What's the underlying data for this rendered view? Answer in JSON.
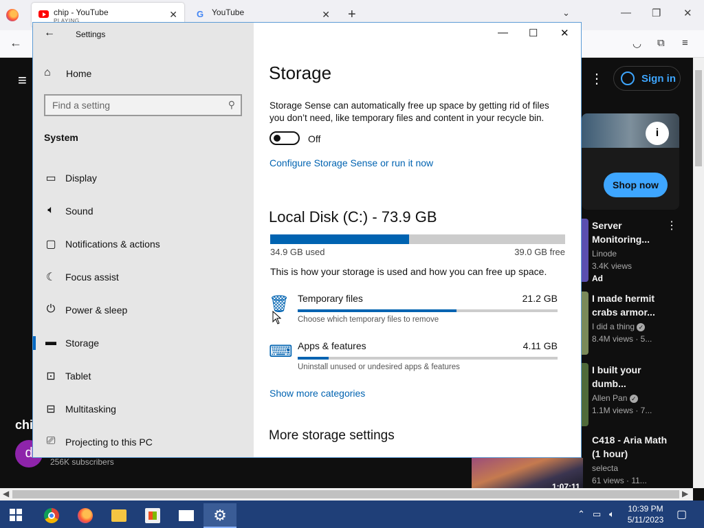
{
  "browser": {
    "tabs": [
      {
        "title": "chip - YouTube",
        "subtitle": "PLAYING",
        "active": true
      },
      {
        "title": "YouTube",
        "active": false
      }
    ]
  },
  "youtube": {
    "sign_in": "Sign in",
    "shop_now": "Shop now",
    "channel_name": "chi",
    "channel_avatar": "d",
    "subscribers": "256K subscribers",
    "bottom_duration": "1:07:11",
    "videos": [
      {
        "title": "Server Monitoring...",
        "channel": "Linode",
        "views": "3.4K views",
        "extra": "Ad"
      },
      {
        "title": "I made hermit crabs armor...",
        "channel": "I did a thing",
        "views": "8.4M views · 5..."
      },
      {
        "title": "I built your dumb...",
        "channel": "Allen Pan",
        "views": "1.1M views · 7..."
      },
      {
        "title": "C418 - Aria Math (1 hour)",
        "channel": "selecta",
        "views": "61 views · 11..."
      }
    ]
  },
  "settings": {
    "window_title": "Settings",
    "home": "Home",
    "search_placeholder": "Find a setting",
    "section": "System",
    "nav": [
      {
        "label": "Display",
        "icon": "display-icon"
      },
      {
        "label": "Sound",
        "icon": "sound-icon"
      },
      {
        "label": "Notifications & actions",
        "icon": "notifications-icon"
      },
      {
        "label": "Focus assist",
        "icon": "moon-icon"
      },
      {
        "label": "Power & sleep",
        "icon": "power-icon"
      },
      {
        "label": "Storage",
        "icon": "storage-icon",
        "selected": true
      },
      {
        "label": "Tablet",
        "icon": "tablet-icon"
      },
      {
        "label": "Multitasking",
        "icon": "multitasking-icon"
      },
      {
        "label": "Projecting to this PC",
        "icon": "projecting-icon"
      }
    ],
    "content": {
      "title": "Storage",
      "description": "Storage Sense can automatically free up space by getting rid of files you don’t need, like temporary files and content in your recycle bin.",
      "toggle_state": "Off",
      "configure_link": "Configure Storage Sense or run it now",
      "disk_title": "Local Disk (C:) - 73.9 GB",
      "used": "34.9 GB used",
      "free": "39.0 GB free",
      "used_fraction": 0.472,
      "how": "This is how your storage is used and how you can free up space.",
      "categories": [
        {
          "name": "Temporary files",
          "size": "21.2 GB",
          "desc": "Choose which temporary files to remove",
          "fraction": 0.61,
          "icon": "trash-icon"
        },
        {
          "name": "Apps & features",
          "size": "4.11 GB",
          "desc": "Uninstall unused or undesired apps & features",
          "fraction": 0.12,
          "icon": "keyboard-icon"
        }
      ],
      "show_more": "Show more categories",
      "more_title": "More storage settings"
    }
  },
  "taskbar": {
    "time": "10:39 PM",
    "date": "5/11/2023"
  },
  "colors": {
    "accent": "#0063b1",
    "taskbar": "#1f3f78",
    "youtube_bg": "#0f0f0f"
  }
}
